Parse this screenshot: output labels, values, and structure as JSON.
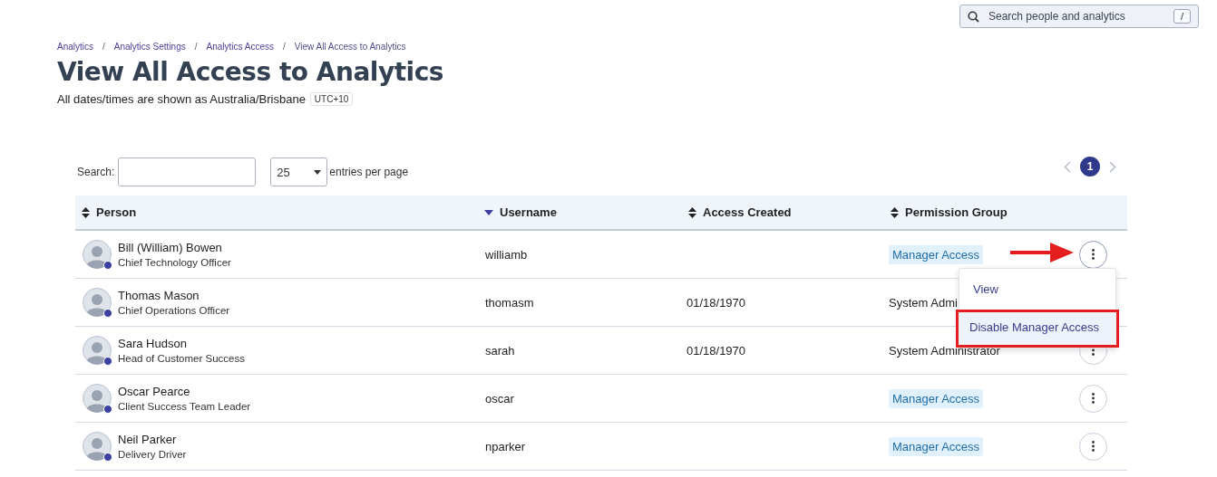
{
  "global_search": {
    "placeholder": "Search people and analytics",
    "shortcut": "/"
  },
  "breadcrumb_separator": "/",
  "breadcrumbs": [
    "Analytics",
    "Analytics Settings",
    "Analytics Access",
    "View All Access to Analytics"
  ],
  "title": "View All Access to Analytics",
  "timezone_note": {
    "text": "All dates/times are shown as Australia/Brisbane",
    "badge": "UTC+10"
  },
  "table_controls": {
    "search_label": "Search:",
    "page_size": "25",
    "page_size_label": "entries per page",
    "pages": [
      {
        "label": "1",
        "selected": true
      }
    ]
  },
  "columns": [
    {
      "label": "Person",
      "sorted": false
    },
    {
      "label": "Username",
      "sorted": true
    },
    {
      "label": "Access Created",
      "sorted": false
    },
    {
      "label": "Permission Group",
      "sorted": false
    }
  ],
  "rows": [
    {
      "name": "Bill (William) Bowen",
      "role": "Chief Technology Officer",
      "username": "williamb",
      "access_created": "",
      "permission": "Manager Access",
      "kind": "tag",
      "menu_open": true
    },
    {
      "name": "Thomas Mason",
      "role": "Chief Operations Officer",
      "username": "thomasm",
      "access_created": "01/18/1970",
      "permission": "System Admi",
      "kind": "text",
      "menu_open": false
    },
    {
      "name": "Sara Hudson",
      "role": "Head of Customer Success",
      "username": "sarah",
      "access_created": "01/18/1970",
      "permission": "System Administrator",
      "kind": "text",
      "menu_open": false
    },
    {
      "name": "Oscar Pearce",
      "role": "Client Success Team Leader",
      "username": "oscar",
      "access_created": "",
      "permission": "Manager Access",
      "kind": "tag",
      "menu_open": false
    },
    {
      "name": "Neil Parker",
      "role": "Delivery Driver",
      "username": "nparker",
      "access_created": "",
      "permission": "Manager Access",
      "kind": "tag",
      "menu_open": false
    }
  ],
  "row_menu": {
    "items": [
      {
        "label": "View",
        "highlighted": false
      },
      {
        "label": "Disable Manager Access",
        "highlighted": true
      }
    ]
  }
}
